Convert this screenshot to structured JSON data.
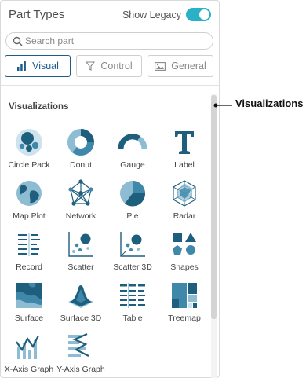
{
  "header": {
    "title": "Part Types",
    "legacy_label": "Show Legacy",
    "legacy_on": true
  },
  "search": {
    "placeholder": "Search part",
    "value": ""
  },
  "tabs": [
    {
      "label": "Visual",
      "icon": "bar-chart-icon",
      "active": true
    },
    {
      "label": "Control",
      "icon": "filter-icon",
      "active": false
    },
    {
      "label": "General",
      "icon": "image-icon",
      "active": false
    }
  ],
  "section": {
    "title": "Visualizations"
  },
  "items": [
    {
      "label": "Circle Pack",
      "icon": "circle-pack-icon"
    },
    {
      "label": "Donut",
      "icon": "donut-icon"
    },
    {
      "label": "Gauge",
      "icon": "gauge-icon"
    },
    {
      "label": "Label",
      "icon": "label-icon"
    },
    {
      "label": "Map Plot",
      "icon": "globe-icon"
    },
    {
      "label": "Network",
      "icon": "network-icon"
    },
    {
      "label": "Pie",
      "icon": "pie-icon"
    },
    {
      "label": "Radar",
      "icon": "radar-icon"
    },
    {
      "label": "Record",
      "icon": "record-icon"
    },
    {
      "label": "Scatter",
      "icon": "scatter-icon"
    },
    {
      "label": "Scatter 3D",
      "icon": "scatter-3d-icon"
    },
    {
      "label": "Shapes",
      "icon": "shapes-icon"
    },
    {
      "label": "Surface",
      "icon": "surface-icon"
    },
    {
      "label": "Surface 3D",
      "icon": "surface-3d-icon"
    },
    {
      "label": "Table",
      "icon": "table-icon"
    },
    {
      "label": "Treemap",
      "icon": "treemap-icon"
    },
    {
      "label": "X-Axis Graph",
      "icon": "x-axis-graph-icon"
    },
    {
      "label": "Y-Axis Graph",
      "icon": "y-axis-graph-icon"
    }
  ],
  "callout": {
    "label": "Visualizations"
  },
  "colors": {
    "accent": "#29b1c7",
    "active_tab": "#1f5c8a",
    "icon_dark": "#1f5f7e",
    "icon_mid": "#3f88aa",
    "icon_light": "#8dbcd3"
  }
}
